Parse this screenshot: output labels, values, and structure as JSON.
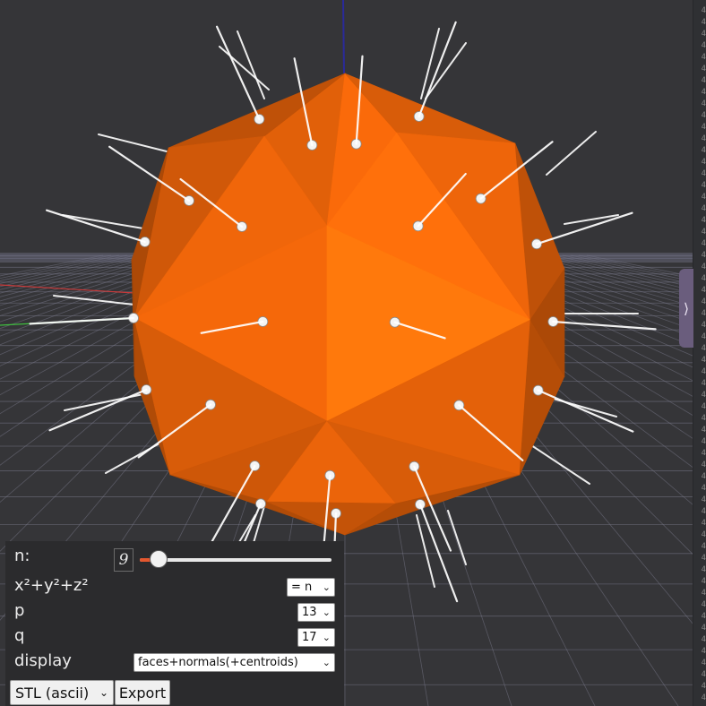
{
  "viewport": {
    "object_color": "#f5680a",
    "grid_color": "#7c7c8e",
    "axis_x_color": "#c83a3a",
    "axis_y_color": "#3fbf3f",
    "axis_z_color": "#2a2a9a",
    "normals_color": "#ffffff"
  },
  "side_panel": {
    "toggle_icon": "⟩"
  },
  "controls": {
    "n": {
      "label": "n:",
      "value": "9",
      "slider_fraction": 0.1
    },
    "sum": {
      "label": "x²+y²+z²",
      "selected": "= n"
    },
    "p": {
      "label": "p",
      "selected": "13"
    },
    "q": {
      "label": "q",
      "selected": "17"
    },
    "display": {
      "label": "display",
      "selected": "faces+normals(+centroids)"
    },
    "format": {
      "selected": "STL (ascii)"
    },
    "export_label": "Export"
  }
}
